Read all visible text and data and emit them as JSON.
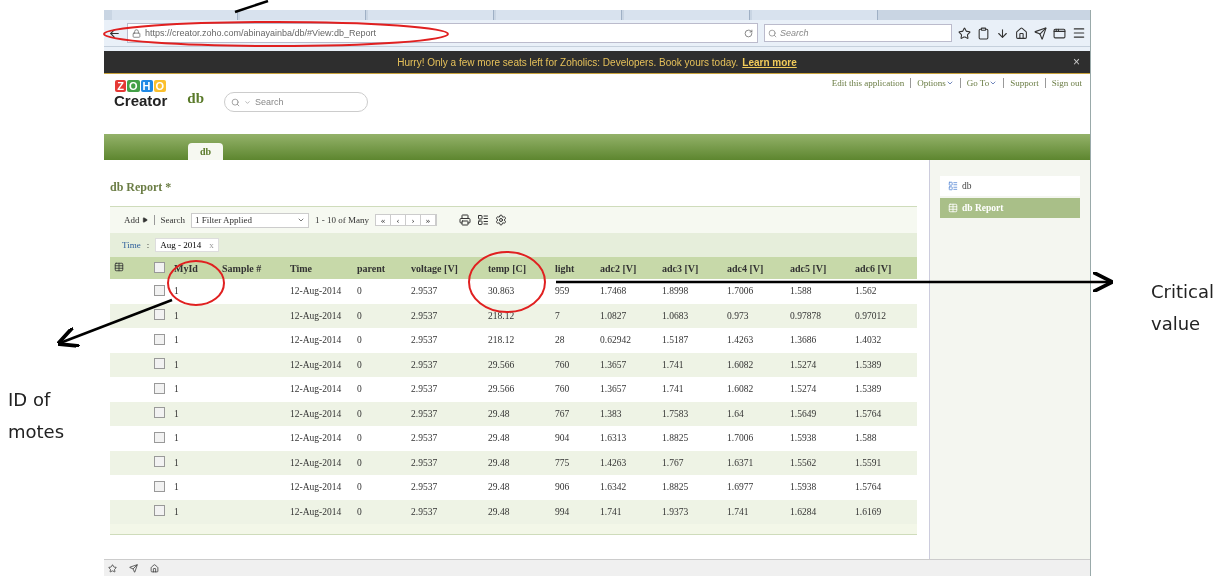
{
  "browser": {
    "url": "https://creator.zoho.com/abinayainba/db/#View:db_Report",
    "search_placeholder": "Search"
  },
  "banner": {
    "text": "Hurry! Only a few more seats left for Zoholics: Developers. Book yours today.",
    "link": "Learn more",
    "close": "×"
  },
  "header": {
    "logo_letters": [
      {
        "char": "Z",
        "color": "#e53935"
      },
      {
        "char": "O",
        "color": "#43a047"
      },
      {
        "char": "H",
        "color": "#1e88e5"
      },
      {
        "char": "O",
        "color": "#fbc02d"
      }
    ],
    "product": "Creator",
    "app_name": "db",
    "search_placeholder": "Search",
    "links": [
      {
        "label": "Edit this application",
        "dropdown": false
      },
      {
        "label": "Options",
        "dropdown": true
      },
      {
        "label": "Go To",
        "dropdown": true
      },
      {
        "label": "Support",
        "dropdown": false
      },
      {
        "label": "Sign out",
        "dropdown": false
      }
    ]
  },
  "tabs": [
    {
      "label": "db",
      "selected": true
    }
  ],
  "report": {
    "title": "db Report *",
    "toolbar": {
      "add": "Add",
      "search": "Search",
      "filter": "1 Filter Applied",
      "range": "1 - 10 of Many",
      "pager": [
        "«",
        "‹",
        "›",
        "»"
      ]
    },
    "filter_chip": {
      "field": "Time",
      "separator": ":",
      "value": "Aug - 2014",
      "remove": "x"
    },
    "select_all_checked": false,
    "columns": [
      "MyId",
      "Sample #",
      "Time",
      "parent",
      "voltage [V]",
      "temp [C]",
      "light",
      "adc2 [V]",
      "adc3 [V]",
      "adc4 [V]",
      "adc5 [V]",
      "adc6 [V]"
    ],
    "rows": [
      {
        "checked": false,
        "cells": [
          "1",
          null,
          "12-Aug-2014",
          "0",
          "2.9537",
          "30.863",
          "959",
          "1.7468",
          "1.8998",
          "1.7006",
          "1.588",
          "1.562"
        ]
      },
      {
        "checked": false,
        "cells": [
          "1",
          null,
          "12-Aug-2014",
          "0",
          "2.9537",
          "218.12",
          "7",
          "1.0827",
          "1.0683",
          "0.973",
          "0.97878",
          "0.97012"
        ]
      },
      {
        "checked": false,
        "cells": [
          "1",
          null,
          "12-Aug-2014",
          "0",
          "2.9537",
          "218.12",
          "28",
          "0.62942",
          "1.5187",
          "1.4263",
          "1.3686",
          "1.4032"
        ]
      },
      {
        "checked": false,
        "cells": [
          "1",
          null,
          "12-Aug-2014",
          "0",
          "2.9537",
          "29.566",
          "760",
          "1.3657",
          "1.741",
          "1.6082",
          "1.5274",
          "1.5389"
        ]
      },
      {
        "checked": false,
        "cells": [
          "1",
          null,
          "12-Aug-2014",
          "0",
          "2.9537",
          "29.566",
          "760",
          "1.3657",
          "1.741",
          "1.6082",
          "1.5274",
          "1.5389"
        ]
      },
      {
        "checked": false,
        "cells": [
          "1",
          null,
          "12-Aug-2014",
          "0",
          "2.9537",
          "29.48",
          "767",
          "1.383",
          "1.7583",
          "1.64",
          "1.5649",
          "1.5764"
        ]
      },
      {
        "checked": false,
        "cells": [
          "1",
          null,
          "12-Aug-2014",
          "0",
          "2.9537",
          "29.48",
          "904",
          "1.6313",
          "1.8825",
          "1.7006",
          "1.5938",
          "1.588"
        ]
      },
      {
        "checked": false,
        "cells": [
          "1",
          null,
          "12-Aug-2014",
          "0",
          "2.9537",
          "29.48",
          "775",
          "1.4263",
          "1.767",
          "1.6371",
          "1.5562",
          "1.5591"
        ]
      },
      {
        "checked": false,
        "cells": [
          "1",
          null,
          "12-Aug-2014",
          "0",
          "2.9537",
          "29.48",
          "906",
          "1.6342",
          "1.8825",
          "1.6977",
          "1.5938",
          "1.5764"
        ]
      },
      {
        "checked": false,
        "cells": [
          "1",
          null,
          "12-Aug-2014",
          "0",
          "2.9537",
          "29.48",
          "994",
          "1.741",
          "1.9373",
          "1.741",
          "1.6284",
          "1.6169"
        ]
      }
    ]
  },
  "sidebar": {
    "items": [
      {
        "label": "db",
        "kind": "form",
        "selected": false
      },
      {
        "label": "db Report",
        "kind": "report",
        "selected": true
      }
    ]
  },
  "annotations": {
    "left": "ID of motes",
    "right": "Critical value"
  }
}
